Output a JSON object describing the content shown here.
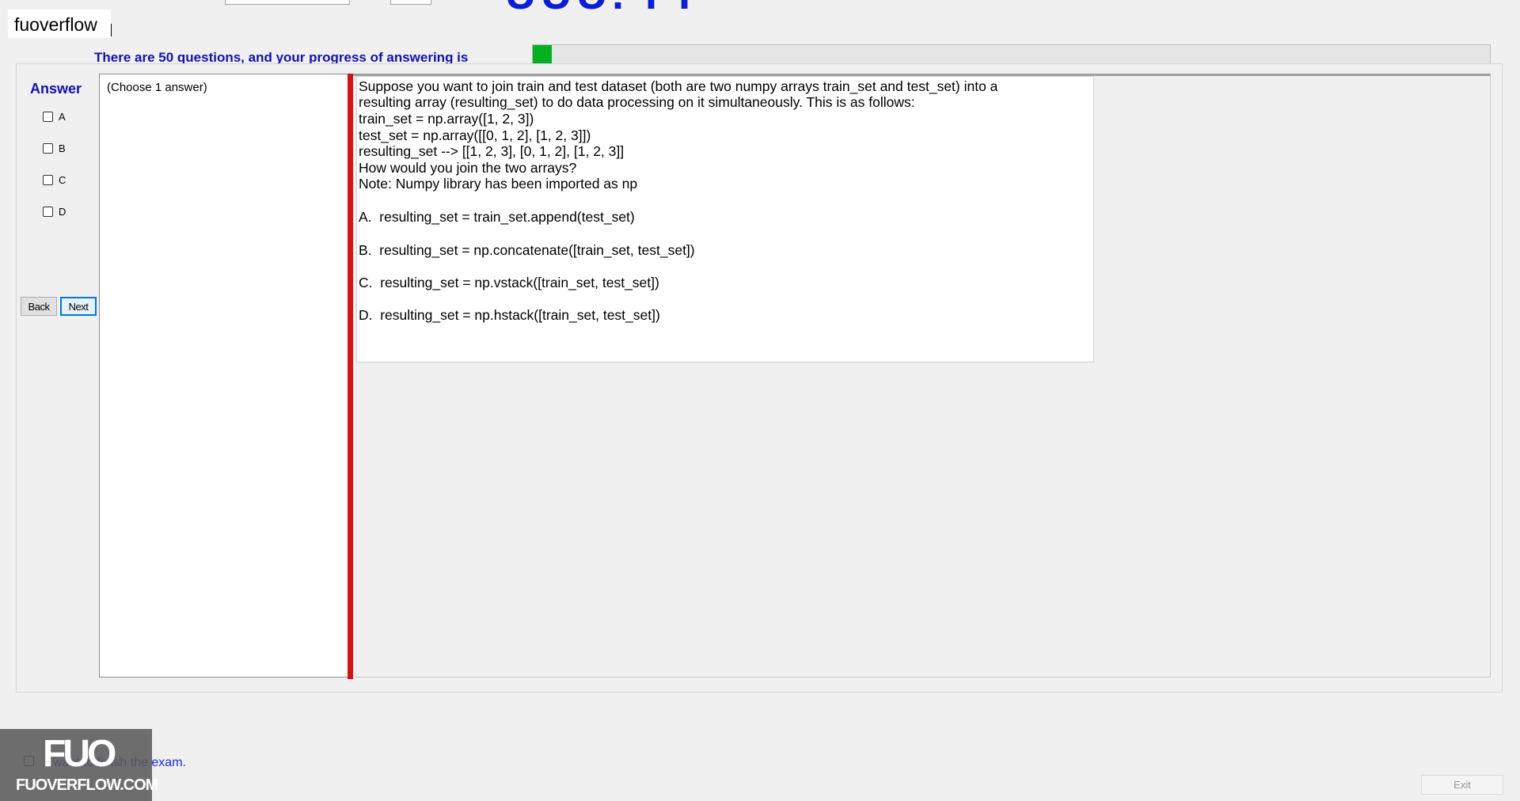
{
  "top": {
    "watermark": "fuoverflow",
    "exam_code_clipped": "UUU. I I"
  },
  "progress": {
    "label": "There are 50 questions, and your progress of answering is",
    "value_percent": 2,
    "fill_color": "#06b025"
  },
  "answer": {
    "title": "Answer",
    "options": [
      "A",
      "B",
      "C",
      "D"
    ],
    "back_label": "Back",
    "next_label": "Next",
    "choose_hint": "(Choose 1 answer)"
  },
  "question": {
    "lines": [
      "Suppose you want to join train and test dataset (both are two numpy arrays train_set and test_set) into a",
      "resulting array (resulting_set) to do data processing on it simultaneously. This is as follows:",
      "train_set = np.array([1, 2, 3])",
      "test_set = np.array([[0, 1, 2], [1, 2, 3]])",
      "resulting_set --> [[1, 2, 3], [0, 1, 2], [1, 2, 3]]",
      "How would you join the two arrays?",
      "Note: Numpy library has been imported as np"
    ],
    "choices": [
      "A.  resulting_set = train_set.append(test_set)",
      "B.  resulting_set = np.concatenate([train_set, test_set])",
      "C.  resulting_set = np.vstack([train_set, test_set])",
      "D.  resulting_set = np.hstack([train_set, test_set])"
    ]
  },
  "footer": {
    "finish_text": "I want to finish the exam.",
    "exit_label": "Exit",
    "logo_big": "FUO",
    "logo_small": "FUOVERFLOW.COM"
  }
}
